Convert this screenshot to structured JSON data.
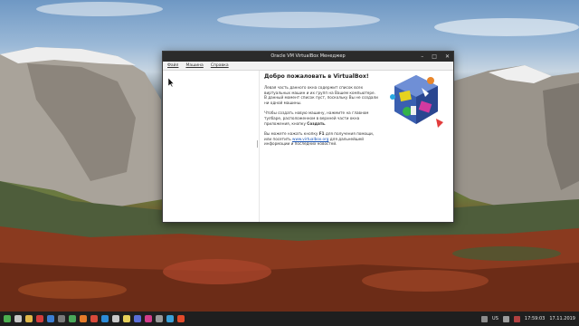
{
  "window": {
    "title": "Oracle VM VirtualBox Менеджер",
    "menu": [
      "Файл",
      "Машина",
      "Справка"
    ]
  },
  "welcome": {
    "title": "Добро пожаловать в VirtualBox!",
    "p1": "Левая часть данного окна содержит список всех виртуальных машин и их групп на Вашем компьютере. В данный момент список пуст, поскольку Вы не создали ни одной машины.",
    "p2a": "Чтобы создать новую машину, нажмите на главном тулбаре, расположенном в верхней части окна приложения, кнопку ",
    "p2b": "Создать",
    "p2c": ".",
    "p3a": "Вы можете нажать кнопку ",
    "p3b": "F1",
    "p3c": " для получения помощи, или посетить ",
    "p3link": "www.virtualbox.org",
    "p3d": " для дальнейшей информации и последних новостей."
  },
  "taskbar": {
    "layout": "US",
    "time": "17:59:03",
    "date": "17.11.2019"
  }
}
